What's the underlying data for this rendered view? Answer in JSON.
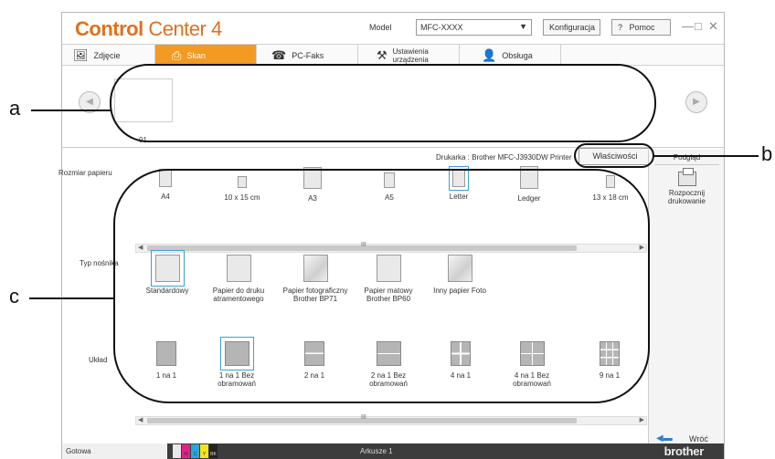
{
  "app": {
    "logo_bold": "Control",
    "logo_light": "Center 4",
    "model_label": "Model",
    "model_value": "MFC-XXXX",
    "config_label": "Konfiguracja",
    "help_label": "Pomoc",
    "help_icon": "?",
    "minimize": "—",
    "maximize": "□",
    "close": "✕"
  },
  "tabs": [
    {
      "label": "Zdjęcie",
      "icon": "photo-icon"
    },
    {
      "label": "Skan",
      "icon": "scan-icon"
    },
    {
      "label": "PC-Faks",
      "icon": "fax-icon"
    },
    {
      "label": "Ustawienia urządzenia",
      "line1": "Ustawienia",
      "line2": "urządzenia",
      "icon": "device-settings-icon"
    },
    {
      "label": "Obsługa",
      "icon": "support-icon"
    }
  ],
  "active_tab": "Skan",
  "thumbnails": [
    {
      "label": "01"
    }
  ],
  "printer_text": "Drukarka : Brother MFC-J3930DW Printer",
  "properties_label": "Właściwości",
  "right_panel": {
    "preview": "Podgląd",
    "print_line1": "Rozpocznij",
    "print_line2": "drukowanie",
    "back": "Wróć"
  },
  "paper_size": {
    "label": "Rozmiar papieru",
    "options": [
      "A4",
      "10 x 15 cm",
      "A3",
      "A5",
      "Letter",
      "Ledger",
      "13 x 18 cm"
    ],
    "selected": "Letter"
  },
  "media_type": {
    "label": "Typ nośnika",
    "options": [
      {
        "line1": "Standardowy",
        "line2": ""
      },
      {
        "line1": "Papier do druku",
        "line2": "atramentowego"
      },
      {
        "line1": "Papier fotograficzny",
        "line2": "Brother BP71"
      },
      {
        "line1": "Papier matowy",
        "line2": "Brother BP60"
      },
      {
        "line1": "Inny papier Foto",
        "line2": ""
      }
    ],
    "selected": "Standardowy"
  },
  "layout": {
    "label": "Układ",
    "options": [
      {
        "line1": "1 na 1",
        "line2": ""
      },
      {
        "line1": "1 na 1 Bez",
        "line2": "obramowań"
      },
      {
        "line1": "2 na 1",
        "line2": ""
      },
      {
        "line1": "2 na 1 Bez",
        "line2": "obramowań"
      },
      {
        "line1": "4 na 1",
        "line2": ""
      },
      {
        "line1": "4 na 1 Bez",
        "line2": "obramowań"
      },
      {
        "line1": "9 na 1",
        "line2": ""
      }
    ],
    "selected": "1 na 1 Bez obramowań"
  },
  "scroll_grip": "III",
  "status": {
    "left": "Gotowa",
    "center": "Arkusze 1",
    "brand": "brother",
    "ink_labels": [
      "",
      "M",
      "C",
      "Y",
      "BK"
    ],
    "ink_colors": [
      "#e8e8e8",
      "#e21f8a",
      "#2aa6df",
      "#f5e31a",
      "#222222"
    ]
  },
  "callouts": {
    "a": "a",
    "b": "b",
    "c": "c"
  },
  "colors": {
    "accent": "#f39a23",
    "logo": "#e1701e",
    "selection": "#39a1d8"
  }
}
